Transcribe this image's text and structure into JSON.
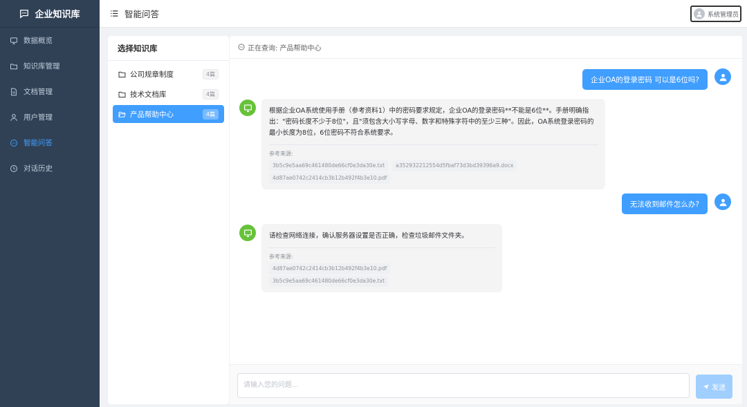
{
  "app": {
    "title": "企业知识库"
  },
  "sidebar": {
    "items": [
      {
        "label": "数据概览",
        "icon": "monitor-icon"
      },
      {
        "label": "知识库管理",
        "icon": "folder-icon"
      },
      {
        "label": "文档管理",
        "icon": "document-icon"
      },
      {
        "label": "用户管理",
        "icon": "user-icon"
      },
      {
        "label": "智能问答",
        "icon": "chat-icon",
        "active": true
      },
      {
        "label": "对话历史",
        "icon": "clock-icon"
      }
    ]
  },
  "header": {
    "page_title": "智能问答",
    "user_name": "系统管理员"
  },
  "kb_panel": {
    "title": "选择知识库",
    "items": [
      {
        "name": "公司规章制度",
        "count": "4篇"
      },
      {
        "name": "技术文档库",
        "count": "4篇"
      },
      {
        "name": "产品帮助中心",
        "count": "4篇",
        "active": true
      }
    ]
  },
  "chat": {
    "querying_label": "正在查询: 产品帮助中心",
    "messages": [
      {
        "role": "user",
        "text": "企业OA的登录密码 可以是6位吗?"
      },
      {
        "role": "bot",
        "text": "根据企业OA系统使用手册（参考资料1）中的密码要求规定，企业OA的登录密码**不能是6位**。手册明确指出：\"密码长度不少于8位\"，且\"须包含大小写字母、数字和特殊字符中的至少三种\"。因此，OA系统登录密码的最小长度为8位，6位密码不符合系统要求。",
        "ref_label": "参考来源:",
        "refs": [
          "3b5c9e5aa69c461480de66cf0e3da30e.txt",
          "a352932212554d5fbaf73d3bd39396a9.docx",
          "4d87ae0742c2414cb3b12b492f4b3e10.pdf"
        ]
      },
      {
        "role": "user",
        "text": "无法收到邮件怎么办?"
      },
      {
        "role": "bot",
        "text": "请检查网络连接，确认服务器设置是否正确，检查垃圾邮件文件夹。",
        "ref_label": "参考来源:",
        "refs": [
          "4d87ae0742c2414cb3b12b492f4b3e10.pdf",
          "3b5c9e5aa69c461480de66cf0e3da30e.txt"
        ]
      }
    ],
    "input_placeholder": "请输入您的问题...",
    "send_label": "发送"
  },
  "colors": {
    "sidebar_bg": "#304156",
    "accent": "#409eff",
    "bot_avatar": "#67c23a",
    "send_disabled": "#a0cfff"
  }
}
